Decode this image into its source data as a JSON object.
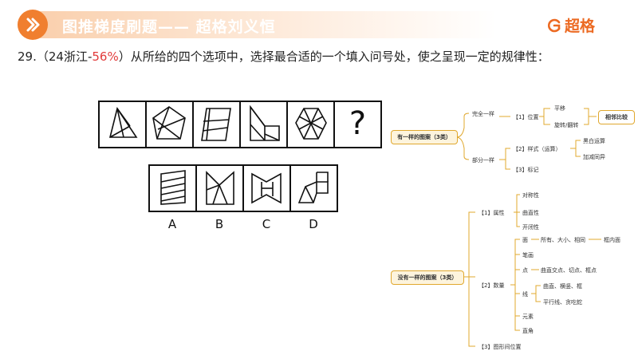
{
  "header": {
    "title": "图推梯度刷题—— 超格刘义恒",
    "brand": "超格",
    "colors": {
      "accent": "#f07f2f",
      "banner": "#f9cda9",
      "percent": "#e23b3b"
    }
  },
  "question": {
    "prefix": "29.（24浙江-",
    "percent": "56%",
    "suffix": "）从所给的四个选项中，选择最合适的一个填入问号处，使之呈现一定的规律性："
  },
  "figure": {
    "question_mark": "?",
    "options": [
      "A",
      "B",
      "C",
      "D"
    ]
  },
  "mindmap": {
    "has_same": {
      "root": "有一样的图案（3类）",
      "complete": "完全一样",
      "position": "【1】位置",
      "translate": "平移",
      "rotate_flip": "旋转/翻转",
      "compare": "相邻比较",
      "partial": "部分一样",
      "style": "【2】样式（运算）",
      "bw_calc": "黑白运算",
      "add_sub": "加减同异",
      "mark": "【3】标记"
    },
    "no_same": {
      "root": "没有一样的图案（3类）",
      "attribute": "【1】属性",
      "symmetry": "对称性",
      "curve_straight": "曲直性",
      "open_closed": "开闭性",
      "quantity": "【2】数量",
      "face": "面",
      "face_detail": "所有、大小、相同",
      "face_inner": "框内面",
      "stroke": "笔画",
      "point": "点",
      "point_detail": "曲直交点、切点、框点",
      "line": "线",
      "line_detail1": "曲直、横竖、框",
      "line_detail2": "平行线、贪吃蛇",
      "element": "元素",
      "right_angle": "直角",
      "relation": "【3】图形间位置"
    }
  }
}
